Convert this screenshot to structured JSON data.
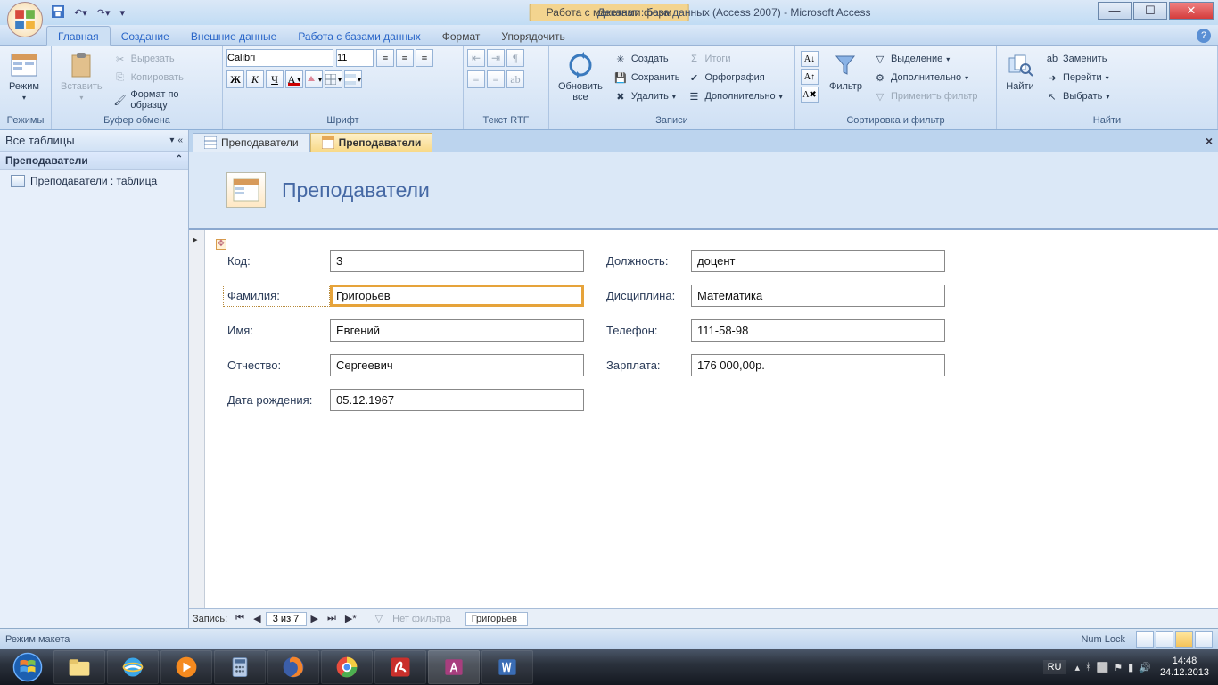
{
  "titlebar": {
    "tools_label": "Работа с макетами форм",
    "app_title": "Деканат : база данных (Access 2007) - Microsoft Access"
  },
  "tabs": {
    "main": "Главная",
    "create": "Создание",
    "external": "Внешние данные",
    "dbtools": "Работа с базами данных",
    "format": "Формат",
    "arrange": "Упорядочить"
  },
  "ribbon": {
    "modes_group": "Режимы",
    "mode_btn": "Режим",
    "clipboard_group": "Буфер обмена",
    "paste": "Вставить",
    "cut": "Вырезать",
    "copy": "Копировать",
    "format_painter": "Формат по образцу",
    "font_group": "Шрифт",
    "font_name": "Calibri",
    "font_size": "11",
    "rtf_group": "Текст RTF",
    "records_group": "Записи",
    "refresh": "Обновить\nвсе",
    "new": "Создать",
    "save": "Сохранить",
    "delete": "Удалить",
    "totals": "Итоги",
    "spelling": "Орфография",
    "more": "Дополнительно",
    "sort_group": "Сортировка и фильтр",
    "filter": "Фильтр",
    "selection": "Выделение",
    "advanced": "Дополнительно",
    "toggle_filter": "Применить фильтр",
    "find_group": "Найти",
    "find": "Найти",
    "replace": "Заменить",
    "goto": "Перейти",
    "select": "Выбрать"
  },
  "nav": {
    "header": "Все таблицы",
    "group": "Преподаватели",
    "item": "Преподаватели : таблица"
  },
  "doc": {
    "tab1": "Преподаватели",
    "tab2": "Преподаватели",
    "form_title": "Преподаватели"
  },
  "fields": {
    "code_l": "Код:",
    "code_v": "3",
    "lastname_l": "Фамилия:",
    "lastname_v": "Григорьев",
    "firstname_l": "Имя:",
    "firstname_v": "Евгений",
    "patronymic_l": "Отчество:",
    "patronymic_v": "Сергеевич",
    "dob_l": "Дата рождения:",
    "dob_v": "05.12.1967",
    "position_l": "Должность:",
    "position_v": "доцент",
    "discipline_l": "Дисциплина:",
    "discipline_v": "Математика",
    "phone_l": "Телефон:",
    "phone_v": "111-58-98",
    "salary_l": "Зарплата:",
    "salary_v": "176 000,00р."
  },
  "recnav": {
    "label": "Запись:",
    "pos": "3 из 7",
    "nofilter": "Нет фильтра",
    "search": "Григорьев"
  },
  "status": {
    "mode": "Режим макета",
    "numlock": "Num Lock"
  },
  "tray": {
    "lang": "RU",
    "time": "14:48",
    "date": "24.12.2013"
  }
}
